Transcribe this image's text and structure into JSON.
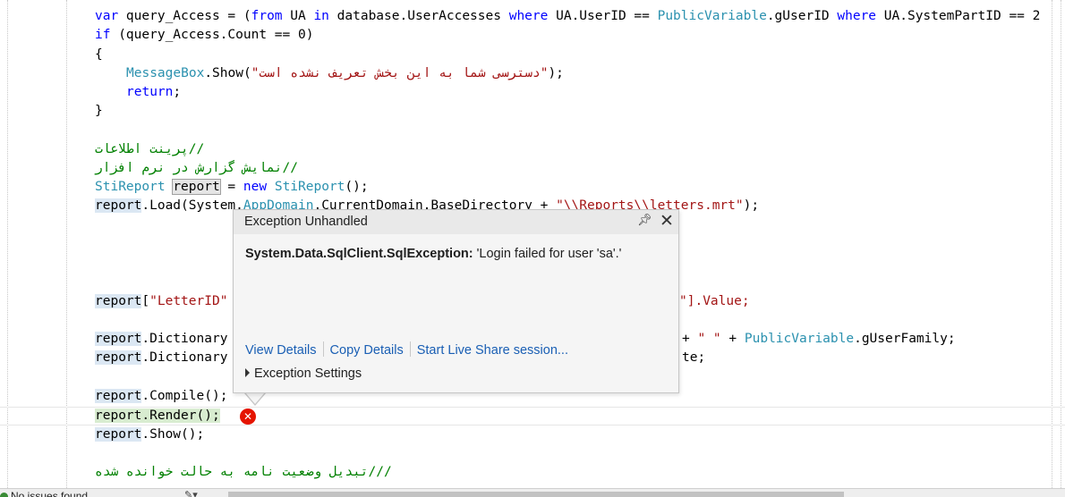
{
  "code": {
    "line1": {
      "p1": "var",
      "p2": " query_Access = (",
      "p3": "from",
      "p4": " UA ",
      "p5": "in",
      "p6": " database.UserAccesses ",
      "p7": "where",
      "p8": " UA.UserID == ",
      "p9": "PublicVariable",
      "p10": ".gUserID ",
      "p11": "where",
      "p12": " UA.SystemPartID == 2"
    },
    "line2": {
      "p1": "if",
      "p2": " (query_Access.Count == 0)"
    },
    "line3": "{",
    "line4": {
      "p1": "MessageBox",
      "p2": ".Show(",
      "p3": "\"دسترسی شما به این بخش تعریف نشده است\"",
      "p4": ");"
    },
    "line5": {
      "p1": "return",
      "p2": ";"
    },
    "line6": "}",
    "comment1": "//پرینت اطلاعات",
    "comment2": "//نمایش گزارش در نرم افزار",
    "line9": {
      "p1": "StiReport",
      "p2": " ",
      "p3": "report",
      "p4": " = ",
      "p5": "new",
      "p6": " ",
      "p7": "StiReport",
      "p8": "();"
    },
    "line10": {
      "p1": "report",
      "p2": ".Load(System.",
      "p3": "AppDomain",
      "p4": ".CurrentDomain.BaseDirectory + ",
      "p5": "\"\\\\Reports\\\\letters.mrt\"",
      "p6": ");"
    },
    "line11": {
      "p1": "report",
      "p2": "[",
      "p3": "\"LetterID\"",
      "p4": "",
      "p5": "\"].Value;"
    },
    "line12": {
      "p1": "report",
      "p2": ".Dictionary",
      "p3": "+ ",
      "p4": "\" \"",
      "p5": " + ",
      "p6": "PublicVariable",
      "p7": ".gUserFamily;"
    },
    "line13": {
      "p1": "report",
      "p2": ".Dictionary",
      "p3": "te;"
    },
    "line14": {
      "p1": "report",
      "p2": ".Compile();"
    },
    "line15": {
      "p1": "report",
      "p2": ".Render();"
    },
    "line16": {
      "p1": "report",
      "p2": ".Show();"
    },
    "comment3": "///تبدیل وضعیت نامه به حالت خوانده شده"
  },
  "exception_popup": {
    "title": "Exception Unhandled",
    "exception_type": "System.Data.SqlClient.SqlException:",
    "exception_message": " 'Login failed for user 'sa'.'",
    "links": {
      "view_details": "View Details",
      "copy_details": "Copy Details",
      "live_share": "Start Live Share session..."
    },
    "settings_label": "Exception Settings",
    "icons": {
      "pin": "pin-icon",
      "close": "close-icon"
    }
  },
  "error_marker": {
    "icon": "error-icon",
    "color": "#e51400"
  },
  "status_bar": {
    "issues_text": "No issues found"
  },
  "colors": {
    "keyword": "#0000ff",
    "type": "#2b91af",
    "string": "#a31515",
    "comment": "#008000",
    "link": "#1a5fb4"
  }
}
